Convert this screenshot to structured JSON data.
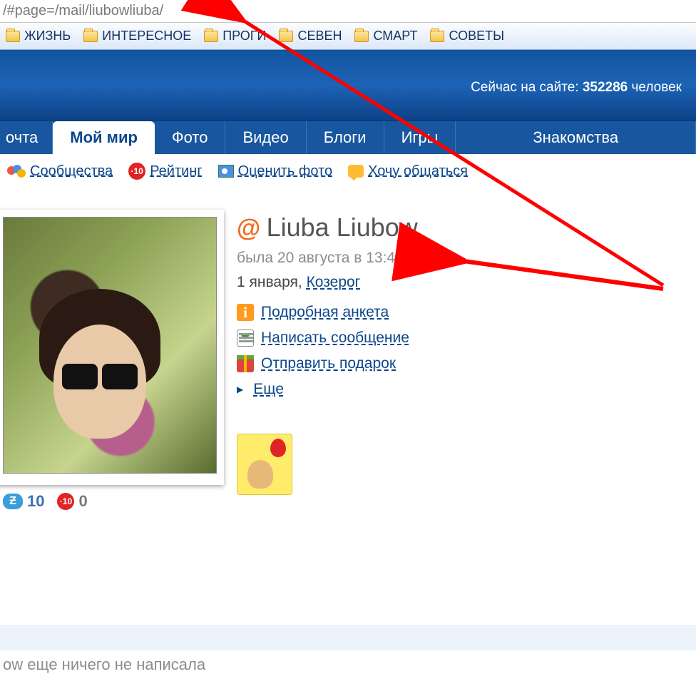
{
  "url_bar": {
    "path": "/#page=/mail/liubowliuba/"
  },
  "bookmarks": {
    "items": [
      {
        "label": "ЖИЗНЬ"
      },
      {
        "label": "ИНТЕРЕСНОЕ"
      },
      {
        "label": "ПРОГИ"
      },
      {
        "label": "СЕВЕН"
      },
      {
        "label": "СМАРТ"
      },
      {
        "label": "СОВЕТЫ"
      }
    ]
  },
  "header": {
    "online_prefix": "Сейчас на сайте: ",
    "online_count": "352286",
    "online_suffix": " человек"
  },
  "nav": {
    "tabs": [
      {
        "label": "очта"
      },
      {
        "label": "Мой мир"
      },
      {
        "label": "Фото"
      },
      {
        "label": "Видео"
      },
      {
        "label": "Блоги"
      },
      {
        "label": "Игры"
      },
      {
        "label": "Знакомства"
      }
    ]
  },
  "sublinks": {
    "communities": "Сообщества",
    "rating": "Рейтинг",
    "rating_badge": "·10",
    "rate_photo": "Оценить фото",
    "want_chat": "Хочу общаться"
  },
  "profile": {
    "at": "@",
    "name": "Liuba Liubow",
    "last_seen": "была 20 августа в 13:49",
    "birth_prefix": "1 января, ",
    "sign": "Козерог",
    "actions": {
      "details": "Подробная анкета",
      "message": "Написать сообщение",
      "gift": "Отправить подарок",
      "more": "Еще"
    },
    "stats": {
      "blue_badge": "Ƶ",
      "blue_value": "10",
      "red_badge": "·10",
      "red_value": "0"
    }
  },
  "footer": {
    "status": "ow еще ничего не написала"
  }
}
